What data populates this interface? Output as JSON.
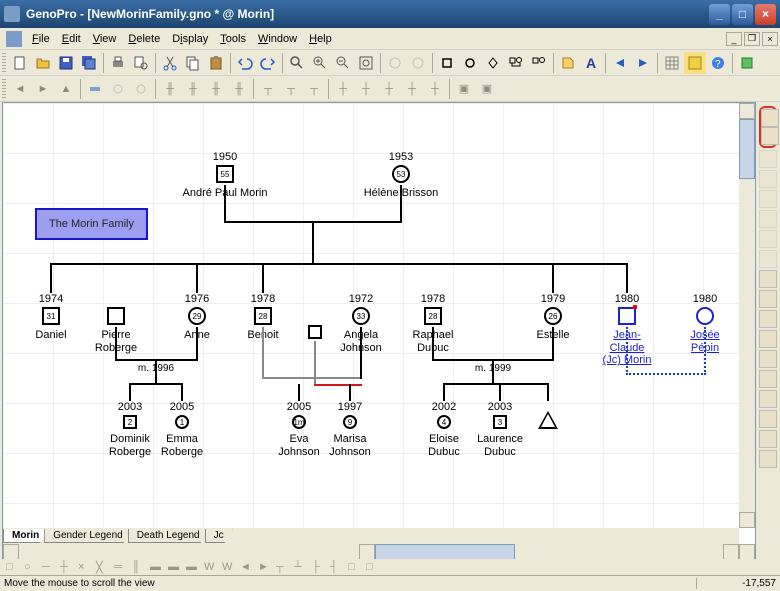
{
  "title": "GenoPro - [NewMorinFamily.gno * @ Morin]",
  "menu": {
    "file": "File",
    "edit": "Edit",
    "view": "View",
    "delete": "Delete",
    "display": "Display",
    "tools": "Tools",
    "window": "Window",
    "help": "Help"
  },
  "tabs": [
    "Morin",
    "Gender Legend",
    "Death Legend",
    "Jc"
  ],
  "status": {
    "message": "Move the mouse to scroll the view",
    "coord": "-17,557"
  },
  "family_box": "The Morin Family",
  "marriage1": "m. 1996",
  "marriage2": "m. 1999",
  "people": {
    "p1": {
      "year": "1950",
      "age": "55",
      "name": "André Paul Morin"
    },
    "p2": {
      "year": "1953",
      "age": "53",
      "name": "Hélène Brisson"
    },
    "d1": {
      "year": "1974",
      "age": "31",
      "name": "Daniel"
    },
    "pr": {
      "name": "Pierre\nRoberge"
    },
    "an": {
      "year": "1976",
      "age": "29",
      "name": "Anne"
    },
    "be": {
      "year": "1978",
      "age": "28",
      "name": "Benoit"
    },
    "aj": {
      "year": "1972",
      "age": "33",
      "name": "Angela\nJohnson"
    },
    "rd": {
      "year": "1978",
      "age": "28",
      "name": "Raphael\nDubuc"
    },
    "es": {
      "year": "1979",
      "age": "26",
      "name": "Estelle"
    },
    "jc": {
      "year": "1980",
      "name": "Jean-\nClaude\n(Jc) Morin"
    },
    "jp": {
      "year": "1980",
      "name": "Josée\nPépin"
    },
    "dr": {
      "year": "2003",
      "age": "2",
      "name": "Dominik\nRoberge"
    },
    "er": {
      "year": "2005",
      "age": "1",
      "name": "Emma\nRoberge"
    },
    "ej": {
      "year": "2005",
      "age": "1m",
      "name": "Eva\nJohnson"
    },
    "mj": {
      "year": "1997",
      "age": "9",
      "name": "Marisa\nJohnson"
    },
    "ed": {
      "year": "2002",
      "age": "4",
      "name": "Eloise\nDubuc"
    },
    "ld": {
      "year": "2003",
      "age": "3",
      "name": "Laurence\nDubuc"
    }
  }
}
